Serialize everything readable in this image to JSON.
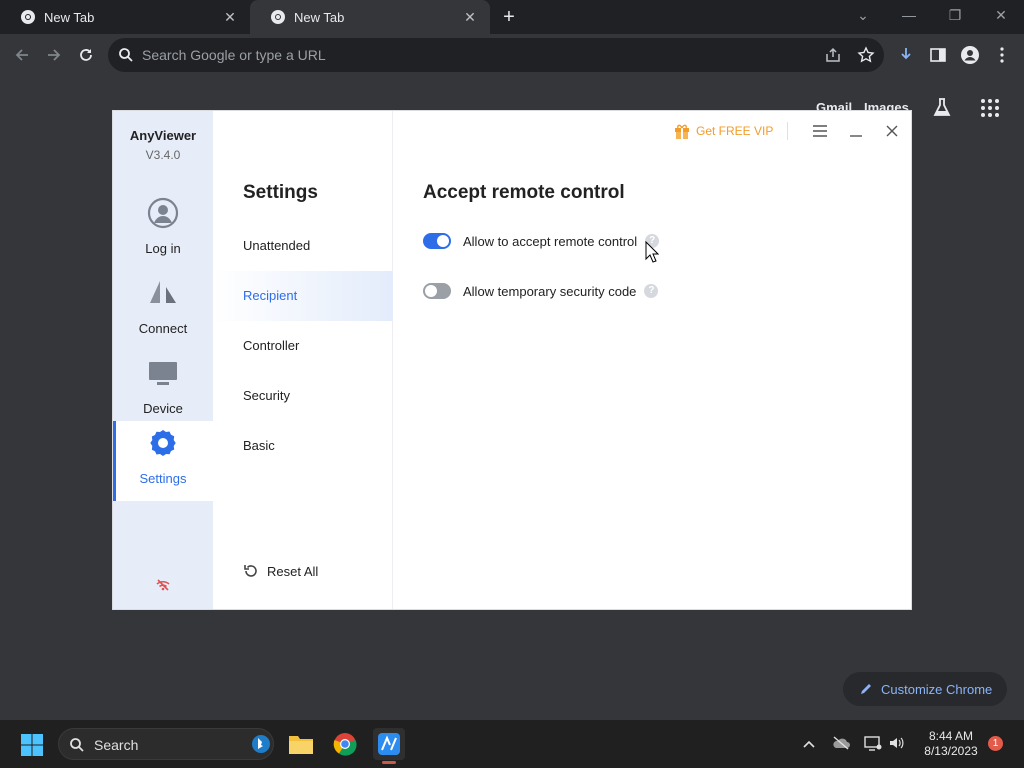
{
  "browser": {
    "tabs": [
      {
        "title": "New Tab"
      },
      {
        "title": "New Tab"
      }
    ],
    "omnibox": {
      "placeholder": "Search Google or type a URL"
    },
    "ntp": {
      "links": [
        "Gmail",
        "Images"
      ],
      "customize_label": "Customize Chrome"
    }
  },
  "anyviewer": {
    "app_name": "AnyViewer",
    "version": "V3.4.0",
    "vip_label": "Get FREE VIP",
    "rail": [
      {
        "label": "Log in",
        "icon": "user-circle-icon"
      },
      {
        "label": "Connect",
        "icon": "connect-arrow-icon"
      },
      {
        "label": "Device",
        "icon": "monitor-icon"
      },
      {
        "label": "Settings",
        "icon": "gear-icon",
        "active": true
      }
    ],
    "settings_title": "Settings",
    "menu": [
      {
        "label": "Unattended"
      },
      {
        "label": "Recipient",
        "active": true
      },
      {
        "label": "Controller"
      },
      {
        "label": "Security"
      },
      {
        "label": "Basic"
      }
    ],
    "reset_label": "Reset All",
    "content": {
      "title": "Accept remote control",
      "options": [
        {
          "label": "Allow to accept remote control",
          "enabled": true
        },
        {
          "label": "Allow temporary security code",
          "enabled": false
        }
      ]
    },
    "accent_color": "#2d6ee8",
    "vip_color": "#f39c2a"
  },
  "taskbar": {
    "search_label": "Search",
    "time": "8:44 AM",
    "date": "8/13/2023",
    "notification_count": "1"
  }
}
